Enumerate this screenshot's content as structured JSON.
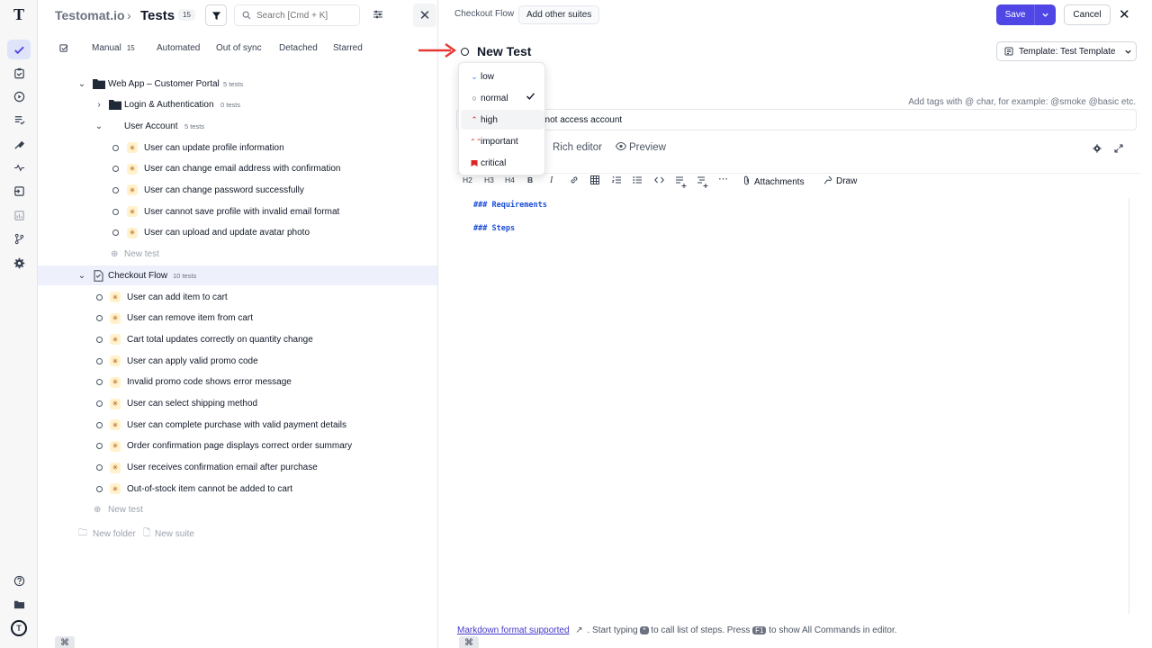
{
  "brand": {
    "logo": "T",
    "bottom_logo": "T"
  },
  "tests_panel": {
    "app_name": "Testomat.io",
    "separator": "›",
    "title": "Tests",
    "count": "15",
    "search": {
      "placeholder": "Search [Cmd + K]"
    },
    "close": "✕",
    "tabs": [
      {
        "label": "Manual",
        "count": "15"
      },
      {
        "label": "Automated"
      },
      {
        "label": "Out of sync"
      },
      {
        "label": "Detached"
      },
      {
        "label": "Starred"
      }
    ],
    "tree": {
      "root": {
        "label": "Web App – Customer Portal",
        "count": "5 tests"
      },
      "login": {
        "label": "Login & Authentication",
        "count": "0 tests"
      },
      "user_account": {
        "label": "User Account",
        "count": "5 tests"
      },
      "user_account_tests": [
        "User can update profile information",
        "User can change email address with confirmation",
        "User can change password successfully",
        "User cannot save profile with invalid email format",
        "User can upload and update avatar photo"
      ],
      "new_test_inner": "New test",
      "checkout": {
        "label": "Checkout Flow",
        "count": "10 tests"
      },
      "checkout_tests": [
        "User can add item to cart",
        "User can remove item from cart",
        "Cart total updates correctly on quantity change",
        "User can apply valid promo code",
        "Invalid promo code shows error message",
        "User can select shipping method",
        "User can complete purchase with valid payment details",
        "Order confirmation page displays correct order summary",
        "User receives confirmation email after purchase",
        "Out-of-stock item cannot be added to cart"
      ],
      "new_test_outer": "New test",
      "new_folder": "New folder",
      "new_suite": "New suite"
    },
    "cmd_key": "⌘"
  },
  "editor": {
    "suite_crumb": "Checkout Flow",
    "add_suites": "Add other suites",
    "save": "Save",
    "cancel": "Cancel",
    "close": "✕",
    "title": "New Test",
    "template": "Template: Test Template",
    "tags_hint": "Add tags with @ char, for example: @smoke @basic etc.",
    "tag_input_value": "nnot access account",
    "mode_tabs": {
      "rich": "Rich editor",
      "preview": "Preview"
    },
    "toolbar": {
      "h2": "H2",
      "h3": "H3",
      "h4": "H4",
      "bold": "B",
      "italic": "I",
      "attachments": "Attachments",
      "draw": "Draw"
    },
    "code_lines": [
      "### Requirements",
      "### Steps"
    ],
    "hint": {
      "link": "Markdown format supported",
      "text1": ". Start typing",
      "key1": "*",
      "text2": "to call list of steps. Press",
      "key2": "F1",
      "text3": "to show All Commands in editor."
    },
    "cmd_key": "⌘"
  },
  "priority_dropdown": {
    "options": [
      {
        "label": "low",
        "icon": "chevron-down-icon",
        "color": "#3b82f6"
      },
      {
        "label": "normal",
        "icon": "circle-icon",
        "color": "#374151",
        "selected": true
      },
      {
        "label": "high",
        "icon": "chevron-up-icon",
        "color": "#dc2626"
      },
      {
        "label": "important",
        "icon": "double-chevron-up-icon",
        "color": "#dc2626"
      },
      {
        "label": "critical",
        "icon": "flag-icon",
        "color": "#dc2626"
      }
    ]
  },
  "colors": {
    "accent": "#4f46e5",
    "annotation_arrow": "#e53935"
  }
}
